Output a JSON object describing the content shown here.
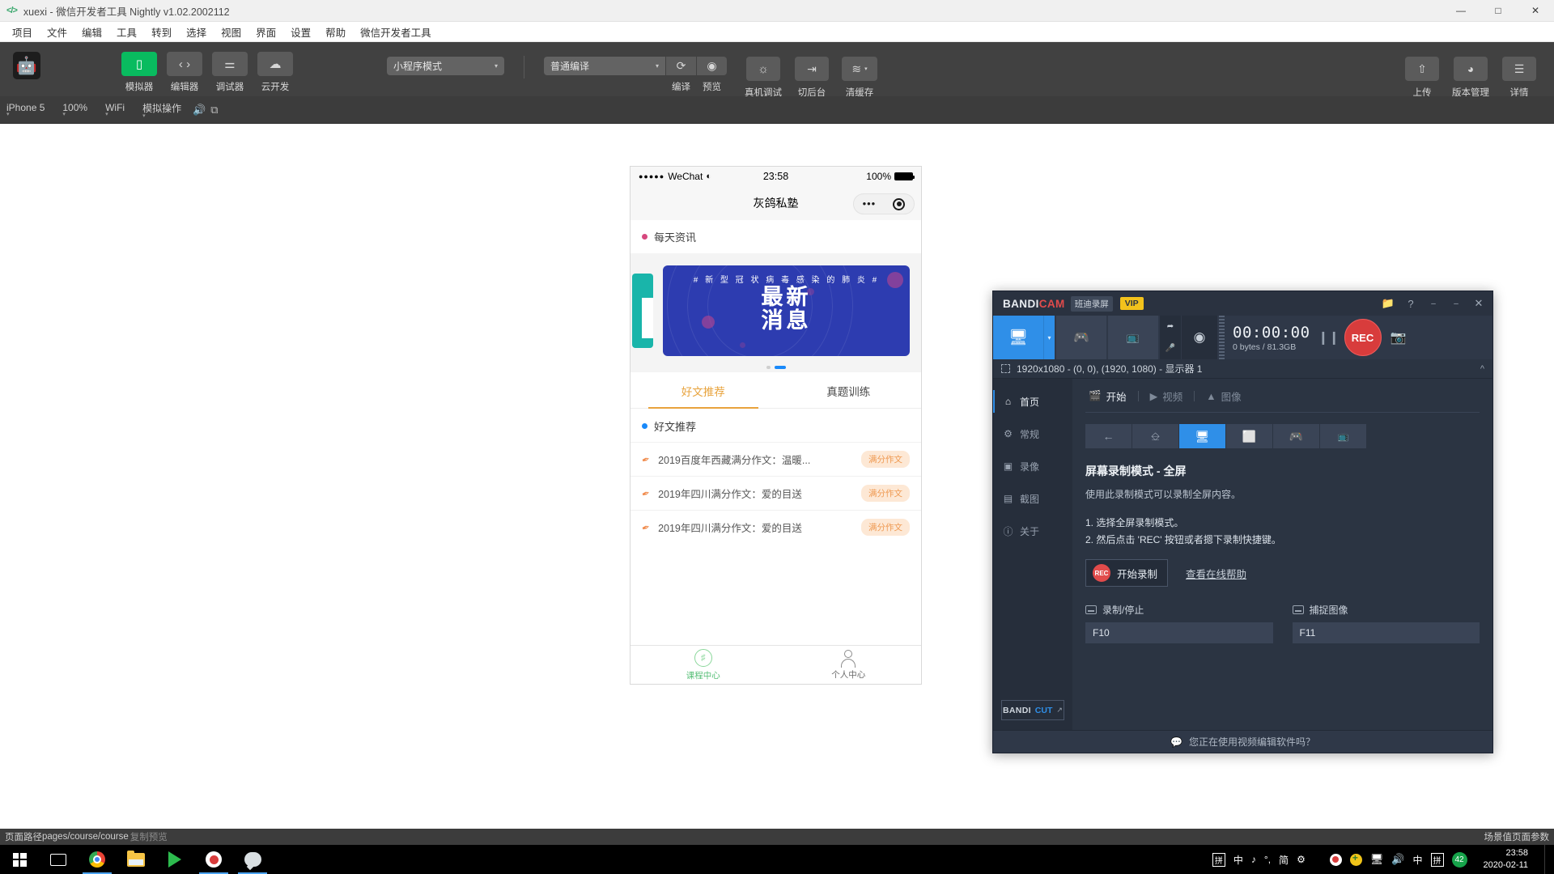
{
  "window": {
    "title": "xuexi - 微信开发者工具 Nightly v1.02.2002112",
    "title_icon": "code-icon",
    "minimize": "—",
    "maximize": "□",
    "close": "✕"
  },
  "menubar": {
    "items": [
      "项目",
      "文件",
      "编辑",
      "工具",
      "转到",
      "选择",
      "视图",
      "界面",
      "设置",
      "帮助",
      "微信开发者工具"
    ]
  },
  "toolbar": {
    "app_icon": "android-icon",
    "panels": [
      {
        "label": "模拟器",
        "icon": "phone-icon",
        "glyph": "▯",
        "active": true
      },
      {
        "label": "编辑器",
        "icon": "code-icon",
        "glyph": "‹ ›",
        "active": false
      },
      {
        "label": "调试器",
        "icon": "debugger-icon",
        "glyph": "⚌",
        "active": false
      },
      {
        "label": "云开发",
        "icon": "cloud-icon",
        "glyph": "☁",
        "active": false
      }
    ],
    "mode_select": {
      "value": "小程序模式",
      "caret": "▾"
    },
    "compile_select": {
      "value": "普通编译",
      "caret": "▾"
    },
    "compile_button": {
      "label": "编译",
      "icon": "refresh-icon",
      "glyph": "⟳"
    },
    "preview_button": {
      "label": "预览",
      "icon": "eye-icon",
      "glyph": "◉"
    },
    "remote_debug_button": {
      "label": "真机调试",
      "icon": "bug-icon",
      "glyph": "🐞"
    },
    "background_button": {
      "label": "切后台",
      "icon": "arrow-to-line-icon",
      "glyph": "⇥"
    },
    "clear_cache_button": {
      "label": "清缓存",
      "icon": "layers-icon",
      "glyph": "≋",
      "caret": "▾"
    },
    "upload_button": {
      "label": "上传",
      "icon": "upload-icon",
      "glyph": "⇧"
    },
    "version_button": {
      "label": "版本管理",
      "icon": "branch-icon",
      "glyph": "ᛘ"
    },
    "details_button": {
      "label": "详情",
      "icon": "hamburger-icon",
      "glyph": "☰"
    }
  },
  "devicebar": {
    "items": [
      {
        "label": "iPhone 5",
        "caret": "▾"
      },
      {
        "label": "100%",
        "caret": "▾"
      },
      {
        "label": "WiFi",
        "caret": "▾"
      },
      {
        "label": "模拟操作",
        "caret": "▾"
      }
    ],
    "mute_icon": "speaker-icon",
    "rotate_icon": "rotate-screen-icon"
  },
  "simulator": {
    "status": {
      "signal_dots": "●●●●●",
      "carrier": "WeChat",
      "wifi_icon": "wifi-icon",
      "time": "23:58",
      "battery_percent": "100%"
    },
    "nav": {
      "title": "灰鸽私塾",
      "capsule_more": "•••",
      "capsule_target_icon": "target-icon"
    },
    "section_news": {
      "dot_color": "#d6487e",
      "title": "每天资讯"
    },
    "banner": {
      "hashtag": "# 新 型 冠 状 病 毒 感 染 的 肺 炎 #",
      "line1": "最新",
      "line2": "消息",
      "bg_color": "#2d3cb0",
      "side_color": "#19b5aa"
    },
    "carousel": {
      "dots": 2,
      "active_index": 1
    },
    "tabs": [
      {
        "label": "好文推荐",
        "active": true
      },
      {
        "label": "真题训练",
        "active": false
      }
    ],
    "list_header": {
      "dot_color": "#1989fa",
      "title": "好文推荐"
    },
    "list_rows": [
      {
        "icon": "pen-icon",
        "text": "2019百度年西藏满分作文：温暖...",
        "badge": "满分作文"
      },
      {
        "icon": "pen-icon",
        "text": "2019年四川满分作文：爱的目送",
        "badge": "满分作文"
      },
      {
        "icon": "pen-icon",
        "text": "2019年四川满分作文：爱的目送",
        "badge": "满分作文"
      }
    ],
    "tabbar": [
      {
        "label": "课程中心",
        "icon": "course-icon",
        "active": true,
        "color": "#57bf77"
      },
      {
        "label": "个人中心",
        "icon": "person-icon",
        "active": false,
        "color": "#8c8c8c"
      }
    ]
  },
  "bandicam": {
    "titlebar": {
      "logo_part1": "BANDI",
      "logo_part2": "CAM",
      "cn_label": "班迪录屏",
      "vip_label": "VIP",
      "folder_icon": "folder-icon",
      "help_icon": "question-icon",
      "minimize_icon": "minimize-icon",
      "restore_icon": "restore-icon",
      "close_icon": "close-icon"
    },
    "toolbar": {
      "screen_mode_icon": "monitor-icon",
      "screen_mode_caret": "▾",
      "game_mode_icon": "gamepad-icon",
      "device_mode_icon": "hdmi-icon",
      "cursor_icon": "cursor-icon",
      "mic_icon": "microphone-icon",
      "webcam_icon": "webcam-icon",
      "timer": "00:00:00",
      "storage": "0 bytes / 81.3GB",
      "pause_icon": "pause-icon",
      "rec_label": "REC",
      "screenshot_icon": "camera-icon"
    },
    "target_bar": {
      "icon": "selection-icon",
      "text": "1920x1080 - (0, 0), (1920, 1080) - 显示器 1",
      "collapse_icon": "chevron-up-icon"
    },
    "sidebar": [
      {
        "label": "首页",
        "icon": "home-icon",
        "glyph": "⌂",
        "active": true
      },
      {
        "label": "常规",
        "icon": "gear-icon",
        "glyph": "✲",
        "active": false
      },
      {
        "label": "录像",
        "icon": "video-settings-icon",
        "glyph": "▣",
        "active": false
      },
      {
        "label": "截图",
        "icon": "image-settings-icon",
        "glyph": "▤",
        "active": false
      },
      {
        "label": "关于",
        "icon": "info-icon",
        "glyph": "ⓘ",
        "active": false
      }
    ],
    "bandicut": {
      "part1": "BANDI",
      "part2": "CUT",
      "arrow": "↗"
    },
    "subtabs": [
      {
        "label": "开始",
        "icon": "clapboard-icon",
        "glyph": "🎬",
        "active": true
      },
      {
        "label": "视频",
        "icon": "video-icon",
        "glyph": "▶",
        "active": false
      },
      {
        "label": "图像",
        "icon": "picture-icon",
        "glyph": "🖼",
        "active": false
      }
    ],
    "mode_buttons": [
      {
        "icon": "back-arrow-icon",
        "glyph": "←",
        "active": false
      },
      {
        "icon": "rectangle-resize-icon",
        "glyph": "⬂",
        "active": false
      },
      {
        "icon": "monitor-icon",
        "glyph": "🖵",
        "active": true
      },
      {
        "icon": "around-mouse-icon",
        "glyph": "⬚",
        "active": false
      },
      {
        "icon": "gamepad-icon",
        "glyph": "🎮",
        "active": false
      },
      {
        "icon": "hdmi-icon",
        "glyph": "📺",
        "active": false
      }
    ],
    "heading": "屏幕录制模式 - 全屏",
    "description": "使用此录制模式可以录制全屏内容。",
    "steps": [
      "1. 选择全屏录制模式。",
      "2. 然后点击 'REC' 按钮或者摁下录制快捷键。"
    ],
    "start_button": {
      "badge": "REC",
      "label": "开始录制"
    },
    "help_link": "查看在线帮助",
    "hotkeys": [
      {
        "label": "录制/停止",
        "icon": "keyboard-icon",
        "value": "F10"
      },
      {
        "label": "捕捉图像",
        "icon": "keyboard-icon",
        "value": "F11"
      }
    ],
    "footer": {
      "icon": "chat-icon",
      "text": "您正在使用视频编辑软件吗？"
    }
  },
  "statusbar": {
    "page_path_label": "页面路径",
    "page_path_value": "pages/course/course",
    "copy_preview": "复制预览",
    "right_text": "场景值页面参数"
  },
  "taskbar": {
    "start_icon": "windows-icon",
    "taskview_icon": "task-view-icon",
    "apps": [
      {
        "icon": "chrome-icon",
        "name": "chrome",
        "active": true
      },
      {
        "icon": "file-explorer-icon",
        "name": "explorer",
        "active": false
      },
      {
        "icon": "media-player-icon",
        "name": "player",
        "active": false
      },
      {
        "icon": "bandicam-icon",
        "name": "bandicam",
        "active": true
      },
      {
        "icon": "wechat-devtools-icon",
        "name": "devtools",
        "active": true
      }
    ],
    "tray": {
      "keyboard_icon": "ime-pinyin-icon",
      "ime_cn": "中",
      "ime_moon": "♪",
      "ime_punct": "°,",
      "ime_simple": "简",
      "ime_gear": "⚙",
      "rec_icon": "record-icon",
      "plus_icon": "plus-icon",
      "screen_icon": "screen-icon",
      "volume_icon": "volume-icon",
      "ime_cn2": "中",
      "ime_pinyin2": "拼",
      "badge_count": "42"
    },
    "clock": {
      "time": "23:58",
      "date": "2020-02-11"
    }
  }
}
